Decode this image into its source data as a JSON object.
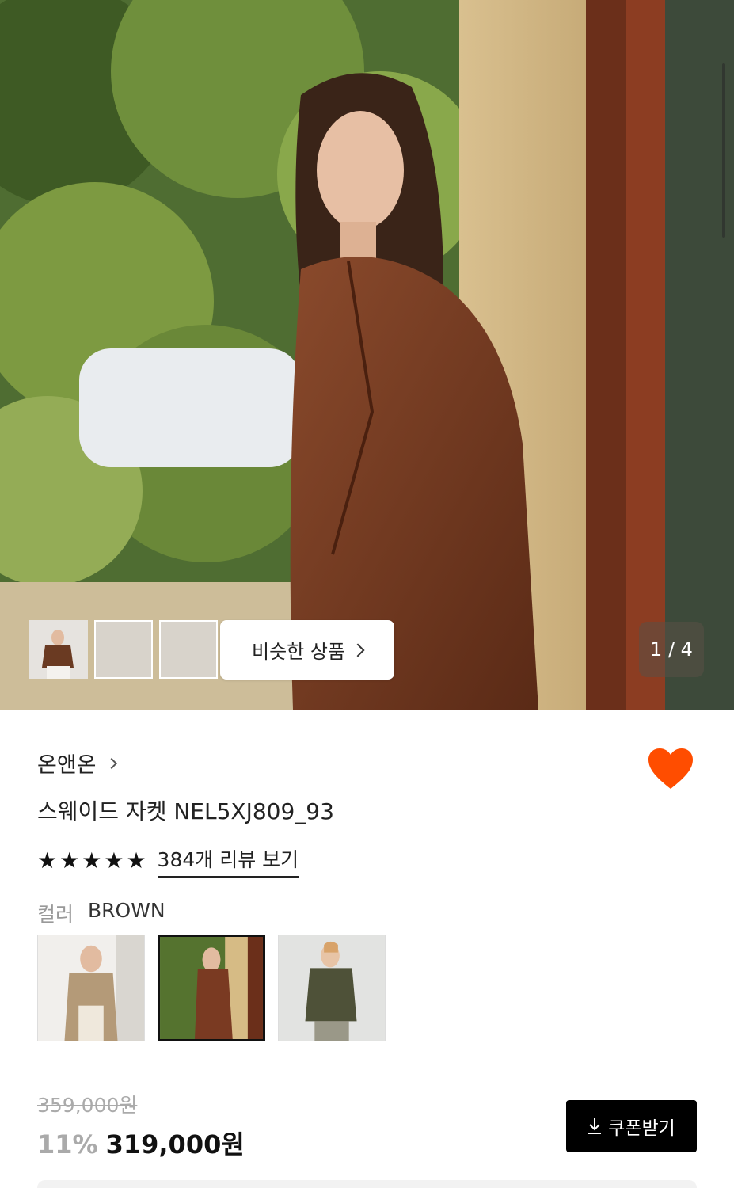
{
  "gallery": {
    "similar_label": "비슷한 상품",
    "counter": "1 / 4",
    "thumbnails": [
      "thumb-1",
      "thumb-2",
      "thumb-3"
    ]
  },
  "product": {
    "brand": "온앤온",
    "name": "스웨이드 자켓 NEL5XJ809_93",
    "rating_stars": 5,
    "review_link": "384개 리뷰 보기",
    "color_label": "컬러",
    "color_value": "BROWN",
    "swatches": [
      "beige",
      "brown",
      "khaki"
    ],
    "selected_swatch": "brown",
    "original_price": "359,000원",
    "discount": "11%",
    "price": "319,000원",
    "coupon_label": "쿠폰받기",
    "liked": true
  },
  "colors": {
    "heart": "#ff4d00",
    "coupon_bg": "#000000"
  },
  "icons": [
    "chevron-right-icon",
    "heart-icon",
    "star-icon",
    "download-icon"
  ]
}
